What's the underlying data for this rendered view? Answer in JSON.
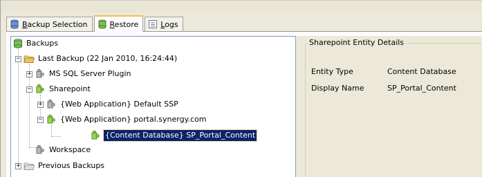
{
  "tabs": [
    {
      "label": "Backup Selection",
      "icon": "database-icon",
      "underline": "B",
      "rest": "ackup Selection"
    },
    {
      "label": "Restore",
      "icon": "database-icon",
      "underline": "R",
      "rest": "estore"
    },
    {
      "label": "Logs",
      "icon": "log-icon",
      "underline": "L",
      "rest": "ogs"
    }
  ],
  "tree": {
    "root": "Backups",
    "last_backup": "Last Backup (22 Jan 2010, 16:24:44)",
    "mssql": "MS SQL Server Plugin",
    "sharepoint": "Sharepoint",
    "webapp_default": "{Web Application} Default SSP",
    "webapp_portal": "{Web Application} portal.synergy.com",
    "content_db": "{Content Database} SP_Portal_Content",
    "workspace": "Workspace",
    "previous": "Previous Backups"
  },
  "details": {
    "group_title": "Sharepoint Entity Details",
    "rows": [
      {
        "label": "Entity Type",
        "value": "Content Database"
      },
      {
        "label": "Display Name",
        "value": "SP_Portal_Content"
      }
    ]
  },
  "colors": {
    "selection": "#0a246a",
    "tab_accent": "#f3c04b",
    "plugin_green": "#8fcf3c",
    "folder_yellow": "#e8c85a"
  }
}
